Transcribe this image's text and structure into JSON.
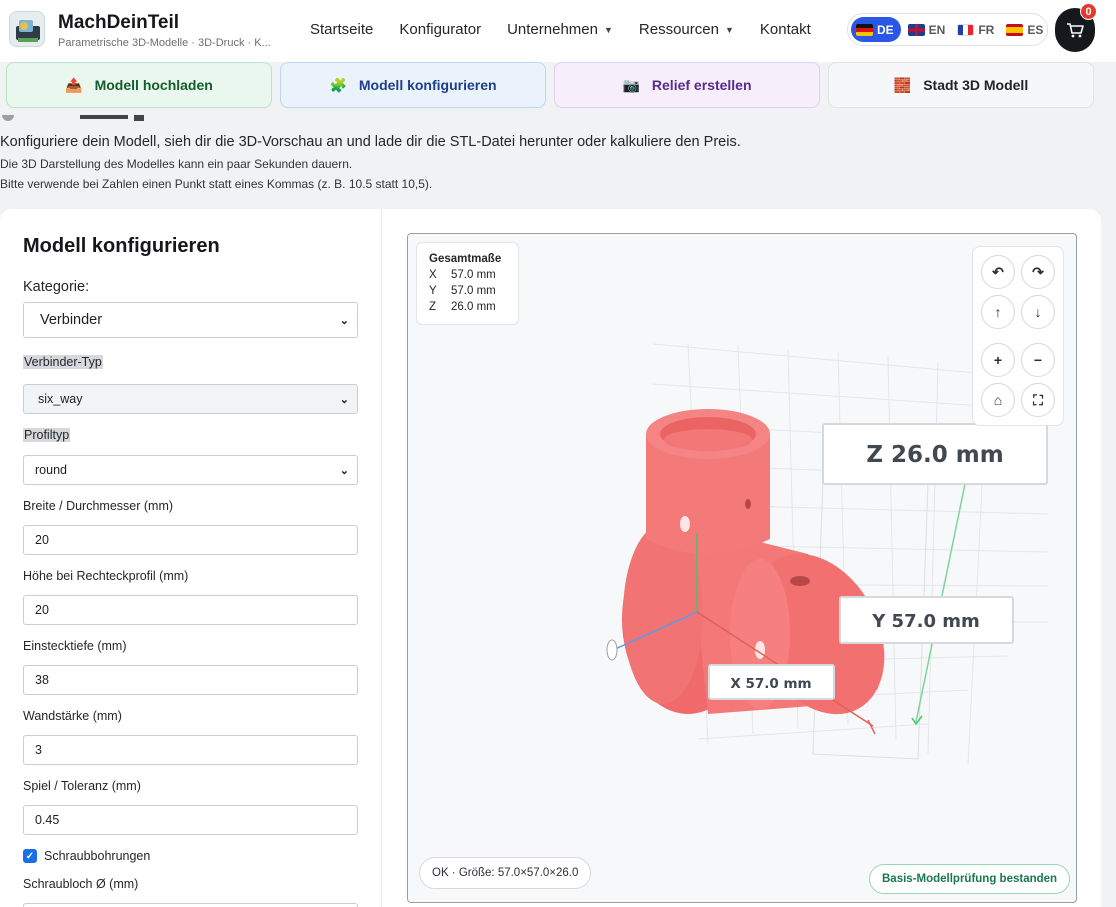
{
  "brand": {
    "title": "MachDeinTeil",
    "subtitle": "Parametrische 3D-Modelle · 3D-Druck · K..."
  },
  "nav": {
    "items": [
      {
        "label": "Startseite",
        "dropdown": false
      },
      {
        "label": "Konfigurator",
        "dropdown": false
      },
      {
        "label": "Unternehmen",
        "dropdown": true
      },
      {
        "label": "Ressourcen",
        "dropdown": true
      },
      {
        "label": "Kontakt",
        "dropdown": false
      }
    ]
  },
  "languages": [
    {
      "code": "DE",
      "flag": "flag-de",
      "active": true
    },
    {
      "code": "EN",
      "flag": "flag-en",
      "active": false
    },
    {
      "code": "FR",
      "flag": "flag-fr",
      "active": false
    },
    {
      "code": "ES",
      "flag": "flag-es",
      "active": false
    }
  ],
  "cart": {
    "count": "0",
    "icon": "cart-icon"
  },
  "tabs": {
    "upload": {
      "label": "Modell hochladen",
      "icon": "📤"
    },
    "config": {
      "label": "Modell konfigurieren",
      "icon": "🧩"
    },
    "relief": {
      "label": "Relief erstellen",
      "icon": "📷"
    },
    "city": {
      "label": "Stadt 3D Modell",
      "icon": "🧱"
    }
  },
  "intro": {
    "line1": "Konfiguriere dein Modell, sieh dir die 3D-Vorschau an und lade dir die STL-Datei herunter oder kalkuliere den Preis.",
    "line2": "Die 3D Darstellung des Modelles kann ein paar Sekunden dauern.",
    "line3": "Bitte verwende bei Zahlen einen Punkt statt eines Kommas (z. B. 10.5 statt 10,5)."
  },
  "form": {
    "title": "Modell konfigurieren",
    "category_label": "Kategorie:",
    "category_value": "Verbinder",
    "connector_type_label": "Verbinder-Typ",
    "connector_type_value": "six_way",
    "profile_type_label": "Profiltyp",
    "profile_type_value": "round",
    "width_label": "Breite / Durchmesser (mm)",
    "width_value": "20",
    "height_label": "Höhe bei Rechteckprofil (mm)",
    "height_value": "20",
    "depth_label": "Einstecktiefe (mm)",
    "depth_value": "38",
    "wall_label": "Wandstärke (mm)",
    "wall_value": "3",
    "tolerance_label": "Spiel / Toleranz (mm)",
    "tolerance_value": "0.45",
    "screw_holes_label": "Schraubbohrungen",
    "screw_holes_checked": true,
    "screw_hole_diameter_label": "Schraubloch Ø (mm)"
  },
  "viewer": {
    "dims_title": "Gesamtmaße",
    "dims": [
      {
        "axis": "X",
        "value": "57.0 mm"
      },
      {
        "axis": "Y",
        "value": "57.0 mm"
      },
      {
        "axis": "Z",
        "value": "26.0 mm"
      }
    ],
    "label_z": "Z 26.0 mm",
    "label_y": "Y 57.0 mm",
    "label_x": "X 57.0 mm",
    "status": "OK · Größe: 57.0×57.0×26.0",
    "check": "Basis-Modellprüfung bestanden",
    "model_color": "#f47878",
    "controls": {
      "rotate_left": "↶",
      "rotate_right": "↷",
      "up": "↑",
      "down": "↓",
      "zoom_in": "+",
      "zoom_out": "−",
      "home": "⌂",
      "fullscreen": "⛶"
    }
  },
  "colors": {
    "accent": "#2a57e6",
    "cart_badge": "#e23a2e",
    "check_green": "#187a4c"
  }
}
